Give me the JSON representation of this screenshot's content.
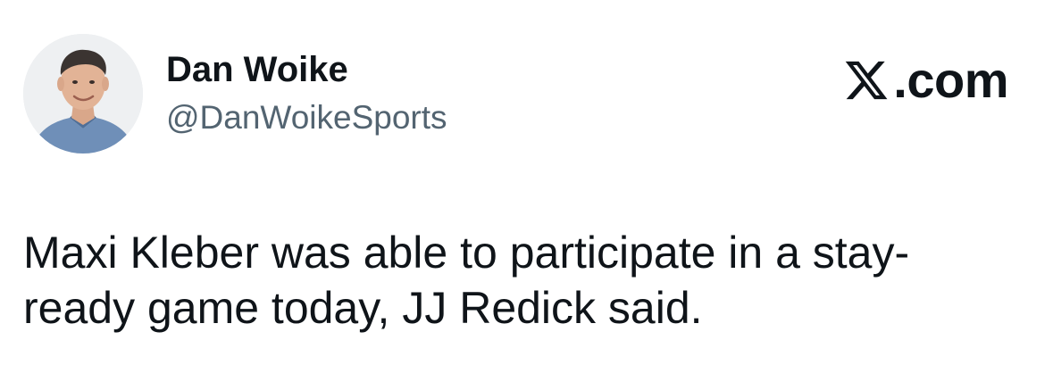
{
  "author": {
    "display_name": "Dan Woike",
    "handle": "@DanWoikeSports",
    "avatar": "profile-photo"
  },
  "brand": {
    "icon": "x-logo-icon",
    "suffix": ".com"
  },
  "tweet": {
    "lines": [
      "Maxi Kleber was able to participate in a stay-",
      "ready game today, JJ Redick said."
    ]
  }
}
